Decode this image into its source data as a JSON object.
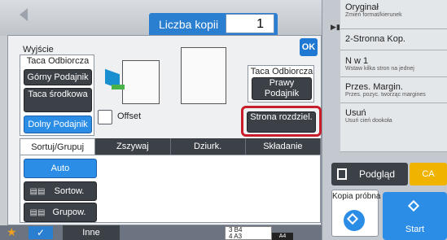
{
  "header": {
    "copies_label": "Liczba kopii",
    "copies_value": "1"
  },
  "dialog": {
    "title": "Wyjście",
    "ok_label": "OK",
    "left_group_label": "Taca Odbiorcza",
    "tray_buttons": [
      {
        "label": "Górny Podajnik",
        "selected": false
      },
      {
        "label": "Taca środkowa",
        "selected": false
      },
      {
        "label": "Dolny Podajnik",
        "selected": true
      }
    ],
    "offset_label": "Offset",
    "right_group_label": "Taca Odbiorcza",
    "right_tray_button": "Prawy Podajnik",
    "separator_button": "Strona rozdziel.",
    "tabs": [
      "Sortuj/Grupuj",
      "Zszywaj",
      "Dziurk.",
      "Składanie"
    ],
    "sort_buttons": [
      {
        "label": "Auto",
        "selected": true
      },
      {
        "label": "Sortow.",
        "selected": false
      },
      {
        "label": "Grupow.",
        "selected": false
      }
    ]
  },
  "bottom": {
    "other_label": "Inne",
    "paper_rows": [
      "3  B4",
      "4  A3"
    ],
    "paper_size": "A4"
  },
  "right_panel": {
    "items": [
      {
        "title": "Oryginał",
        "subtitle": "Zmień format/kierunek"
      },
      {
        "title": "2-Stronna Kop.",
        "subtitle": ""
      },
      {
        "title": "N w 1",
        "subtitle": "Wstaw kilka stron na jednej"
      },
      {
        "title": "Przes. Margin.",
        "subtitle": "Przes. pozyc. tworząc margines"
      },
      {
        "title": "Usuń",
        "subtitle": "Usuń cień dookoła"
      }
    ],
    "preview_label": "Podgląd",
    "ca_label": "CA",
    "proof_label": "Kopia próbna",
    "start_label": "Start"
  },
  "colors": {
    "accent": "#2c8de6",
    "highlight": "#c81d2a",
    "ca": "#f0b400"
  }
}
